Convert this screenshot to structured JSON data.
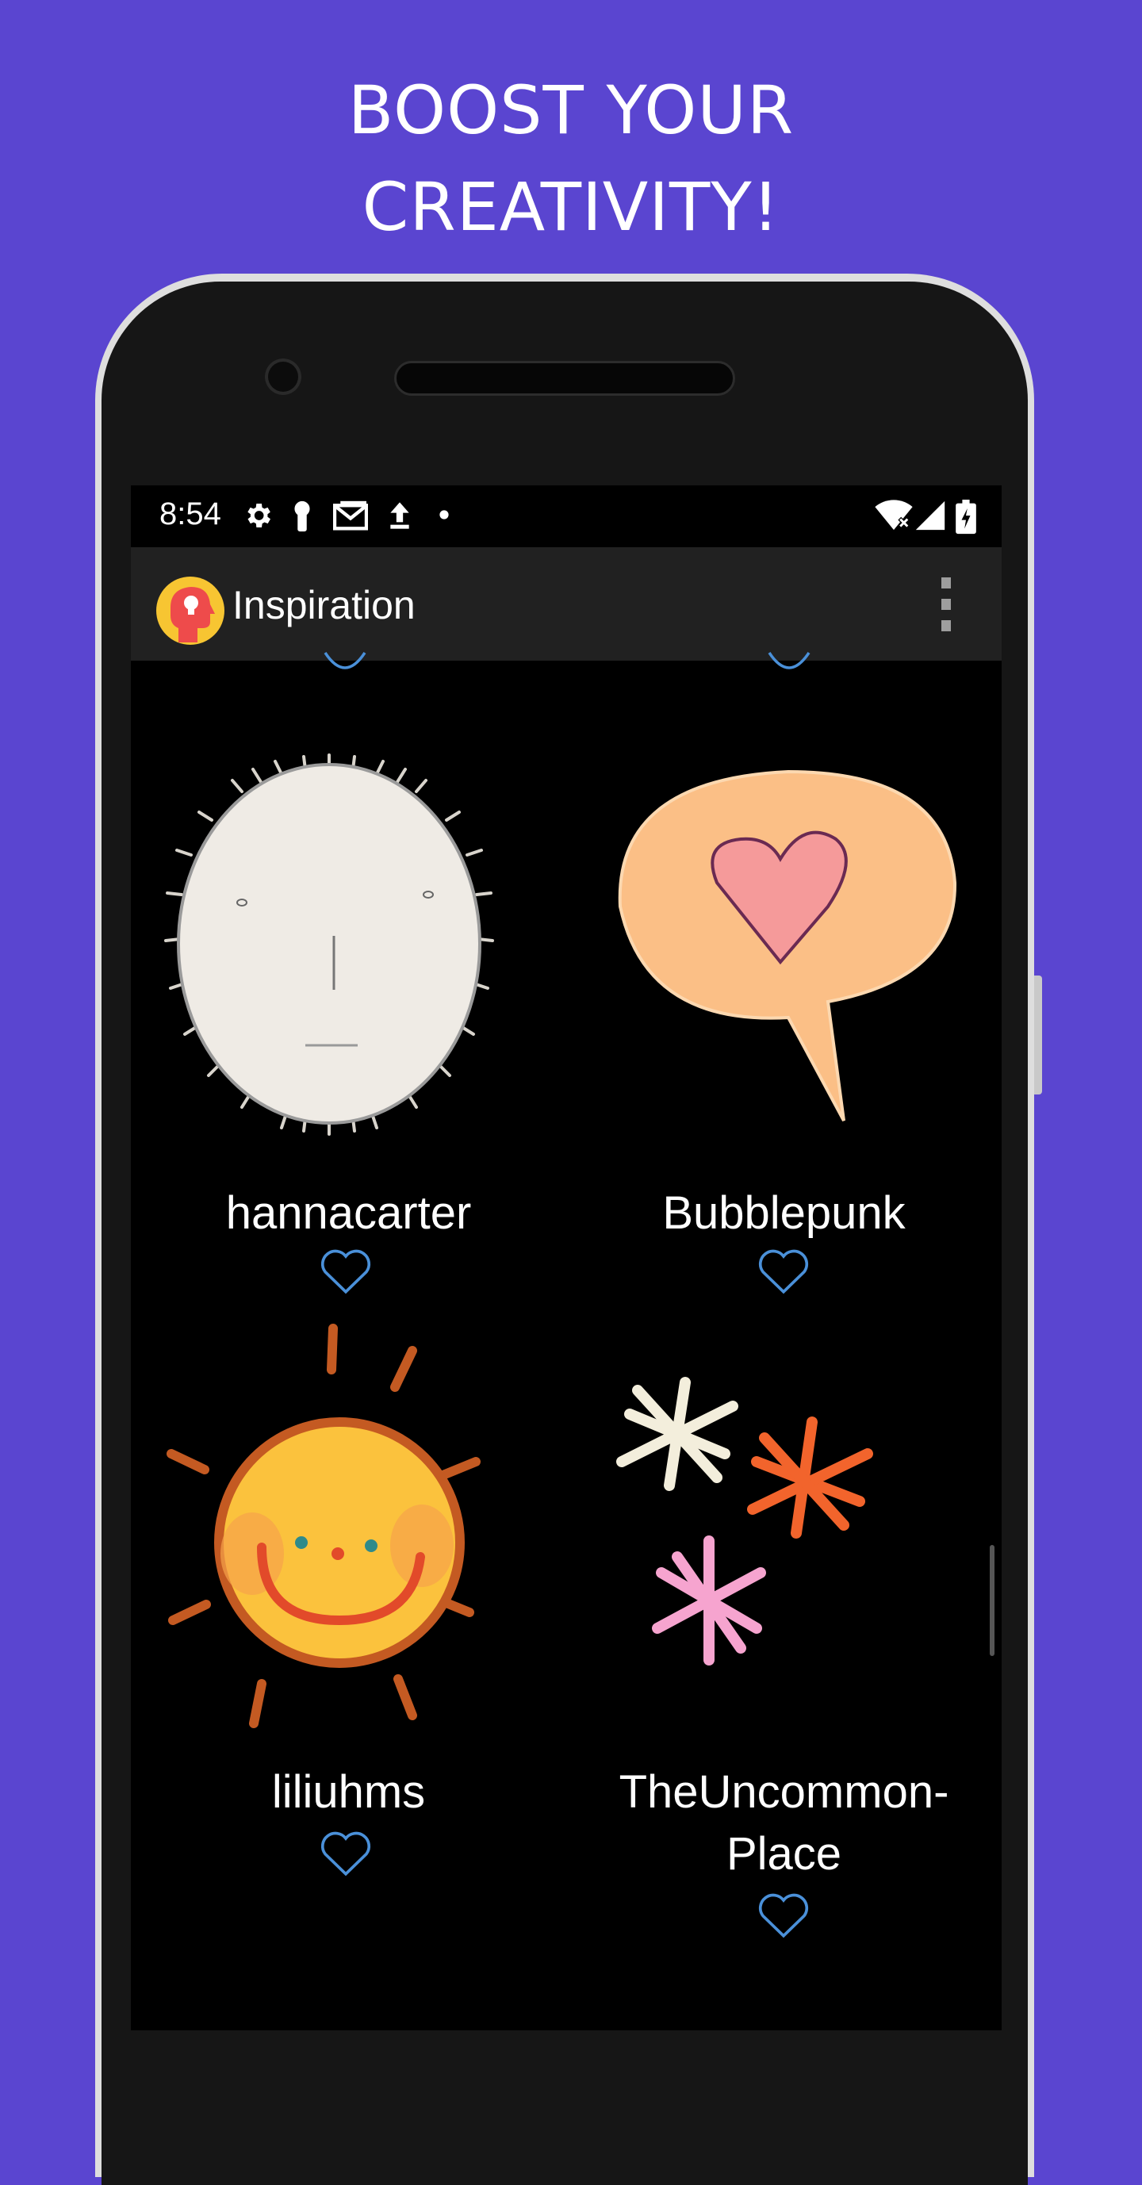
{
  "promo": {
    "headline_line1": "BOOST YOUR",
    "headline_line2": "CREATIVITY!"
  },
  "status_bar": {
    "time": "8:54",
    "left_icons": [
      "gear-icon",
      "keyhole-icon",
      "gmail-icon",
      "upload-icon",
      "dot-icon"
    ],
    "right_icons": [
      "wifi-icon",
      "signal-icon",
      "battery-icon"
    ]
  },
  "app_bar": {
    "title": "Inspiration",
    "logo": "head-lightbulb-logo",
    "menu_icon": "more-vert-icon"
  },
  "grid": {
    "items": [
      {
        "label": "hannacarter",
        "art": "white-face-sticker",
        "liked": false
      },
      {
        "label": "Bubblepunk",
        "art": "heart-speech-bubble-sticker",
        "liked": false
      },
      {
        "label": "liliuhms",
        "art": "smiling-sun-sticker",
        "liked": false
      },
      {
        "label": "TheUncommon-\nPlace",
        "art": "asterisk-stars-sticker",
        "liked": false
      }
    ]
  },
  "colors": {
    "background": "#5a45d0",
    "heart_outline": "#4a90d9",
    "app_bar": "#212121"
  }
}
